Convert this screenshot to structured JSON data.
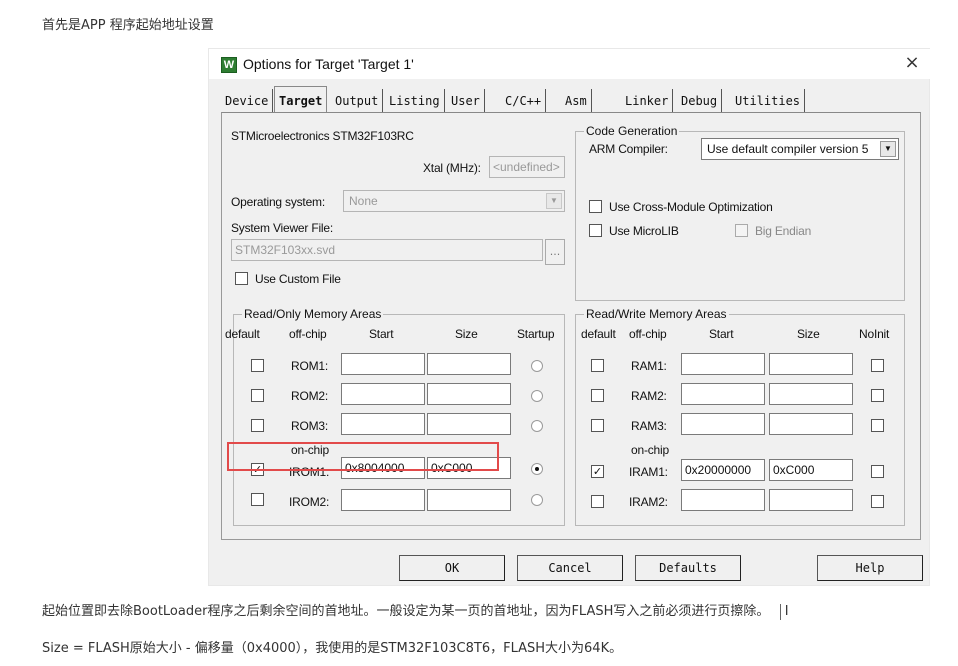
{
  "page": {
    "intro": "首先是APP 程序起始地址设置",
    "para1": "起始位置即去除BootLoader程序之后剩余空间的首地址。一般设定为某一页的首地址，因为FLASH写入之前必须进行页擦除。",
    "para1_cursor": "I",
    "para2": "Size = FLASH原始大小 - 偏移量（0x4000），我使用的是STM32F103C8T6，FLASH大小为64K。"
  },
  "dialog": {
    "title": "Options for Target 'Target 1'",
    "close_glyph": "×",
    "icon_glyph": "W",
    "tabs": [
      "Device",
      "Target",
      "Output",
      "Listing",
      "User",
      "C/C++",
      "Asm",
      "Linker",
      "Debug",
      "Utilities"
    ],
    "active_tab": "Target"
  },
  "target": {
    "device_name": "STMicroelectronics STM32F103RC",
    "xtal_label": "Xtal (MHz):",
    "xtal_value": "<undefined>",
    "os_label": "Operating system:",
    "os_value": "None",
    "svf_label": "System Viewer File:",
    "svf_value": "STM32F103xx.svd",
    "browse_label": "...",
    "custom_file_label": "Use Custom File"
  },
  "codegen": {
    "title": "Code Generation",
    "compiler_label": "ARM Compiler:",
    "compiler_value": "Use default compiler version 5",
    "cross_module_label": "Use Cross-Module Optimization",
    "microlib_label": "Use MicroLIB",
    "big_endian_label": "Big Endian"
  },
  "rom": {
    "title": "Read/Only Memory Areas",
    "headers": {
      "default": "default",
      "offchip": "off-chip",
      "start": "Start",
      "size": "Size",
      "startup": "Startup"
    },
    "onchip_label": "on-chip",
    "rows": [
      {
        "label": "ROM1:",
        "start": "",
        "size": "",
        "default": false,
        "startup": false
      },
      {
        "label": "ROM2:",
        "start": "",
        "size": "",
        "default": false,
        "startup": false
      },
      {
        "label": "ROM3:",
        "start": "",
        "size": "",
        "default": false,
        "startup": false
      },
      {
        "label": "IROM1:",
        "start": "0x8004000",
        "size": "0xC000",
        "default": true,
        "startup": true
      },
      {
        "label": "IROM2:",
        "start": "",
        "size": "",
        "default": false,
        "startup": false
      }
    ]
  },
  "ram": {
    "title": "Read/Write Memory Areas",
    "headers": {
      "default": "default",
      "offchip": "off-chip",
      "start": "Start",
      "size": "Size",
      "noinit": "NoInit"
    },
    "onchip_label": "on-chip",
    "rows": [
      {
        "label": "RAM1:",
        "start": "",
        "size": "",
        "default": false,
        "noinit": false
      },
      {
        "label": "RAM2:",
        "start": "",
        "size": "",
        "default": false,
        "noinit": false
      },
      {
        "label": "RAM3:",
        "start": "",
        "size": "",
        "default": false,
        "noinit": false
      },
      {
        "label": "IRAM1:",
        "start": "0x20000000",
        "size": "0xC000",
        "default": true,
        "noinit": false
      },
      {
        "label": "IRAM2:",
        "start": "",
        "size": "",
        "default": false,
        "noinit": false
      }
    ]
  },
  "buttons": {
    "ok": "OK",
    "cancel": "Cancel",
    "defaults": "Defaults",
    "help": "Help"
  },
  "colors": {
    "highlight": "#e24a4a",
    "icon_green": "#2e7d32"
  },
  "check_glyph": "✓"
}
